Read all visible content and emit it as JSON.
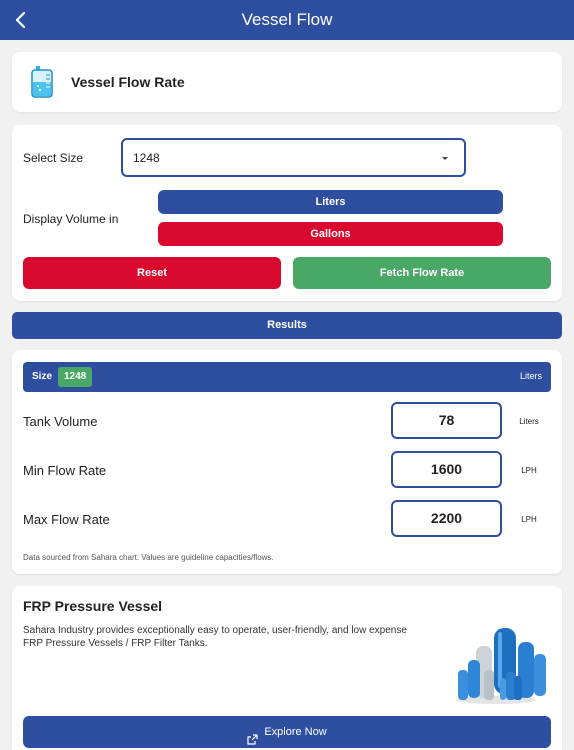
{
  "header": {
    "title": "Vessel Flow"
  },
  "section": {
    "title": "Vessel Flow Rate"
  },
  "form": {
    "select_size_label": "Select Size",
    "selected_size": "1248",
    "display_volume_label": "Display Volume in",
    "liters_label": "Liters",
    "gallons_label": "Gallons",
    "reset_label": "Reset",
    "fetch_label": "Fetch Flow Rate"
  },
  "results": {
    "heading": "Results",
    "size_label": "Size",
    "size_value": "1248",
    "unit_header": "Liters",
    "rows": [
      {
        "label": "Tank Volume",
        "value": "78",
        "unit": "Liters"
      },
      {
        "label": "Min Flow Rate",
        "value": "1600",
        "unit": "LPH"
      },
      {
        "label": "Max Flow Rate",
        "value": "2200",
        "unit": "LPH"
      }
    ],
    "note": "Data sourced from Sahara chart. Values are guideline capacities/flows."
  },
  "promo": {
    "title": "FRP Pressure Vessel",
    "description": "Sahara Industry provides exceptionally easy to operate, user-friendly, and low expense FRP Pressure Vessels / FRP Filter Tanks.",
    "button_label": "Explore Now"
  },
  "colors": {
    "primary": "#2e4fa0",
    "danger": "#d8082f",
    "success": "#4aa867",
    "background": "#f1f1f1"
  }
}
